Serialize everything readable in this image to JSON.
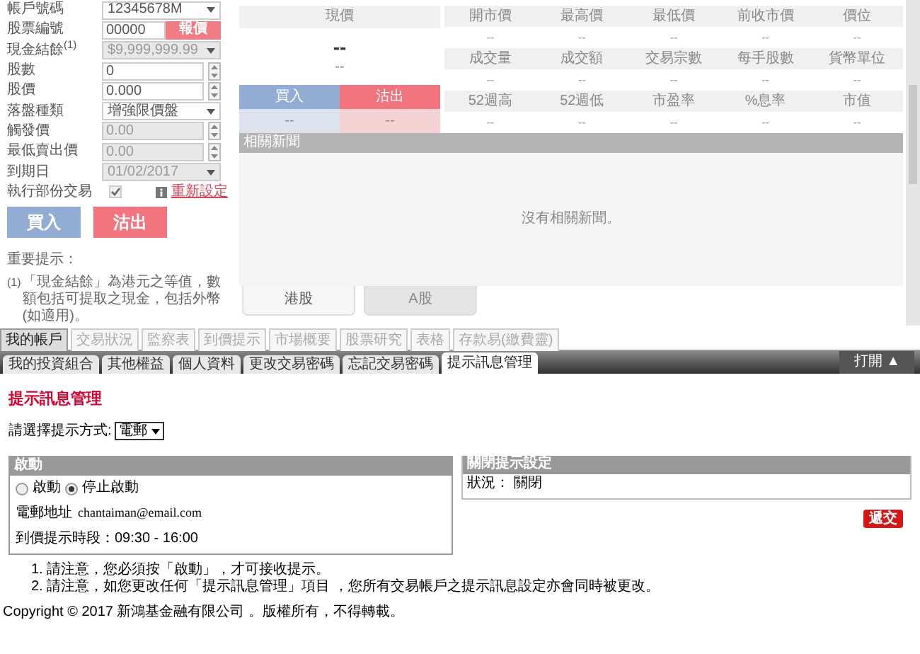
{
  "order_form": {
    "rows": [
      {
        "label": "帳戶號碼",
        "kind": "select",
        "value": "12345678M",
        "disabled": false
      },
      {
        "label": "股票編號",
        "kind": "quote",
        "value": "00000",
        "button": "報價",
        "disabled": false
      },
      {
        "label": "現金結餘$^{(1)}$",
        "kind": "select",
        "value": "$9,999,999.99",
        "disabled": true
      },
      {
        "label": "股數",
        "kind": "spinner",
        "value": "0",
        "disabled": false
      },
      {
        "label": "股價",
        "kind": "spinner",
        "value": "0.000",
        "disabled": false
      },
      {
        "label": "落盤種類",
        "kind": "select",
        "value": "增強限價盤",
        "disabled": false
      },
      {
        "label": "觸發價",
        "kind": "spinner",
        "value": "0.00",
        "disabled": true
      },
      {
        "label": "最低賣出價",
        "kind": "spinner",
        "value": "0.00",
        "disabled": true
      },
      {
        "label": "到期日",
        "kind": "select",
        "value": "01/02/2017",
        "disabled": true
      },
      {
        "label": "執行部份交易",
        "kind": "checkbox",
        "checked": true,
        "link": "重新設定"
      }
    ],
    "buy_button": "買入",
    "sell_button": "沽出",
    "notes_title": "重要提示：",
    "notes": [
      {
        "marker": "(1)",
        "text": "「現金結餘」為港元之等值，數額包括可提取之現金，包括外幣 (如適用)。"
      }
    ]
  },
  "quote": {
    "price_label": "現價",
    "price": "--",
    "change": "--",
    "buy_label": "買入",
    "sell_label": "沽出",
    "buy_value": "--",
    "sell_value": "--",
    "stats": [
      {
        "headers": [
          "開市價",
          "最高價",
          "最低價",
          "前收市價",
          "價位"
        ],
        "values": [
          "--",
          "--",
          "--",
          "--",
          "--"
        ]
      },
      {
        "headers": [
          "成交量",
          "成交額",
          "交易宗數",
          "每手股數",
          "貨幣單位"
        ],
        "values": [
          "--",
          "--",
          "--",
          "--",
          "--"
        ]
      },
      {
        "headers": [
          "52週高",
          "52週低",
          "市盈率",
          "%息率",
          "市值"
        ],
        "values": [
          "--",
          "--",
          "--",
          "--",
          "--"
        ]
      }
    ]
  },
  "news": {
    "title": "相關新聞",
    "empty": "沒有相關新聞。"
  },
  "market_tabs": [
    {
      "label": "港股",
      "selected": true
    },
    {
      "label": "A股",
      "selected": false
    }
  ],
  "nav_tabs": [
    {
      "label": "我的帳戶",
      "selected": true
    },
    {
      "label": "交易狀況",
      "selected": false
    },
    {
      "label": "監察表",
      "selected": false
    },
    {
      "label": "到價提示",
      "selected": false
    },
    {
      "label": "市場概要",
      "selected": false
    },
    {
      "label": "股票研究",
      "selected": false
    },
    {
      "label": "表格",
      "selected": false
    },
    {
      "label": "存款易(繳費靈)",
      "selected": false
    }
  ],
  "sub_tabs": [
    {
      "label": "我的投資組合",
      "selected": false
    },
    {
      "label": "其他權益",
      "selected": false
    },
    {
      "label": "個人資料",
      "selected": false
    },
    {
      "label": "更改交易密碼",
      "selected": false
    },
    {
      "label": "忘記交易密碼",
      "selected": false
    },
    {
      "label": "提示訊息管理",
      "selected": true
    }
  ],
  "toggle": "打開 ▲",
  "alert": {
    "title": "提示訊息管理",
    "method_label": "請選擇提示方式:",
    "method_value": "電郵",
    "activation": {
      "title": "啟動",
      "radios": [
        {
          "label": "啟動",
          "selected": false
        },
        {
          "label": "停止啟動",
          "selected": true
        }
      ],
      "email_label": "電郵地址",
      "email": "chantaiman@email.com",
      "time": "到價提示時段：09:30 - 16:00"
    },
    "closing": {
      "title": "關閉提示設定",
      "status": "狀況： 關閉"
    },
    "submit": "遞交",
    "notes": [
      "1. 請注意，您必須按「啟動」，才可接收提示。",
      "2. 請注意，如您更改任何「提示訊息管理」項目 ，您所有交易帳戶之提示訊息設定亦會同時被更改。"
    ]
  },
  "copyright": "Copyright © 2017 新鴻基金融有限公司 。版權所有，不得轉載。"
}
